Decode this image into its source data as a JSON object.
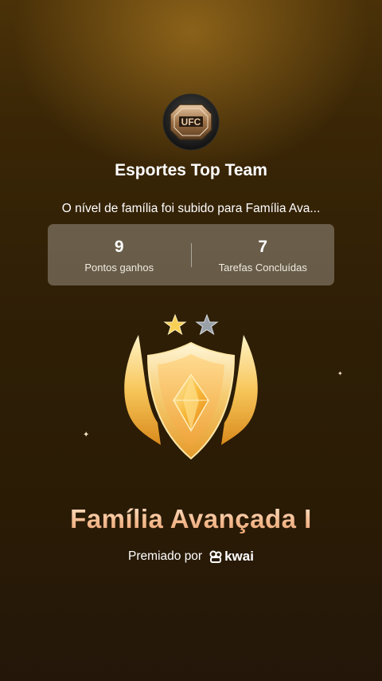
{
  "team": {
    "logo_text": "UFC",
    "name": "Esportes Top Team"
  },
  "message": "O nível de família foi subido para Família Ava...",
  "stats": [
    {
      "value": "9",
      "label": "Pontos ganhos"
    },
    {
      "value": "7",
      "label": "Tarefas Concluídas"
    }
  ],
  "badge": {
    "icon": "shield-badge-icon",
    "stars_filled": 1,
    "stars_total": 2
  },
  "level_title": "Família Avançada I",
  "awarded": {
    "text": "Premiado por",
    "brand": "kwai",
    "brand_icon": "kwai-logo-icon"
  },
  "colors": {
    "accent_gold": "#f3b98d",
    "card_bg": "rgba(255,255,255,0.27)"
  }
}
